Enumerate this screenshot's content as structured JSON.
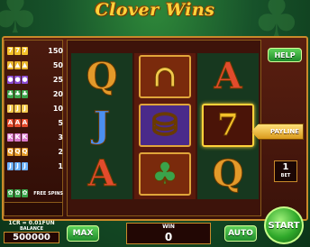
{
  "game": {
    "title": "Clover Wins"
  },
  "paytable": {
    "rows": [
      {
        "icons": [
          "7",
          "7",
          "7"
        ],
        "colors": [
          "#f3c02a",
          "#f3c02a",
          "#f3c02a"
        ],
        "value": "150"
      },
      {
        "icons": [
          "▲",
          "▲",
          "▲"
        ],
        "colors": [
          "#e8b52c",
          "#e8b52c",
          "#e8b52c"
        ],
        "value": "50"
      },
      {
        "icons": [
          "●",
          "●",
          "●"
        ],
        "colors": [
          "#8a4ad0",
          "#8a4ad0",
          "#8a4ad0"
        ],
        "value": "25"
      },
      {
        "icons": [
          "♣",
          "♣",
          "♣"
        ],
        "colors": [
          "#3aa34a",
          "#3aa34a",
          "#3aa34a"
        ],
        "value": "20"
      },
      {
        "icons": [
          "J",
          "J",
          "J"
        ],
        "colors": [
          "#f2c94c",
          "#f2c94c",
          "#f2c94c"
        ],
        "value": "10"
      },
      {
        "icons": [
          "A",
          "A",
          "A"
        ],
        "colors": [
          "#e24b2c",
          "#e24b2c",
          "#e24b2c"
        ],
        "value": "5"
      },
      {
        "icons": [
          "K",
          "K",
          "K"
        ],
        "colors": [
          "#d87acb",
          "#d87acb",
          "#d87acb"
        ],
        "value": "3"
      },
      {
        "icons": [
          "Q",
          "Q",
          "Q"
        ],
        "colors": [
          "#e39a2a",
          "#e39a2a",
          "#e39a2a"
        ],
        "value": "2"
      },
      {
        "icons": [
          "J",
          "J",
          "J"
        ],
        "colors": [
          "#6ab0ff",
          "#6ab0ff",
          "#6ab0ff"
        ],
        "value": "1"
      }
    ],
    "free_spins_label": "FREE SPINS",
    "scatter_icons": [
      "✿",
      "✿",
      "✿"
    ]
  },
  "reels": {
    "columns": [
      [
        {
          "symbol": "Q",
          "color": "#e39a2a",
          "icon": "letter-q-icon"
        },
        {
          "symbol": "J",
          "color": "#4b8ff0",
          "icon": "letter-j-icon"
        },
        {
          "symbol": "A",
          "color": "#e24b2c",
          "icon": "letter-a-icon"
        }
      ],
      [
        {
          "symbol": "∩",
          "color": "#f2c94c",
          "icon": "horseshoe-icon"
        },
        {
          "symbol": "⛁",
          "color": "#f2c94c",
          "icon": "pot-of-gold-icon"
        },
        {
          "symbol": "♣",
          "color": "#3aa34a",
          "icon": "four-leaf-clover-icon"
        }
      ],
      [
        {
          "symbol": "A",
          "color": "#e24b2c",
          "icon": "letter-a-icon"
        },
        {
          "symbol": "7",
          "color": "#f3c02a",
          "icon": "lucky-seven-icon"
        },
        {
          "symbol": "Q",
          "color": "#e39a2a",
          "icon": "letter-q-icon"
        }
      ]
    ]
  },
  "controls": {
    "help_label": "HELP",
    "payline_label": "PAYLINE",
    "bet_value": "1",
    "bet_label": "BET",
    "max_label": "MAX",
    "auto_label": "AUTO",
    "start_label": "START"
  },
  "status": {
    "rate": "1CR = 0.01FUN",
    "balance_label": "BALANCE",
    "balance_value": "500000",
    "win_label": "WIN",
    "win_value": "0"
  },
  "colors": {
    "accent_gold": "#c98a2a",
    "button_green": "#2fa82a",
    "title_gold": "#ffd23a"
  }
}
